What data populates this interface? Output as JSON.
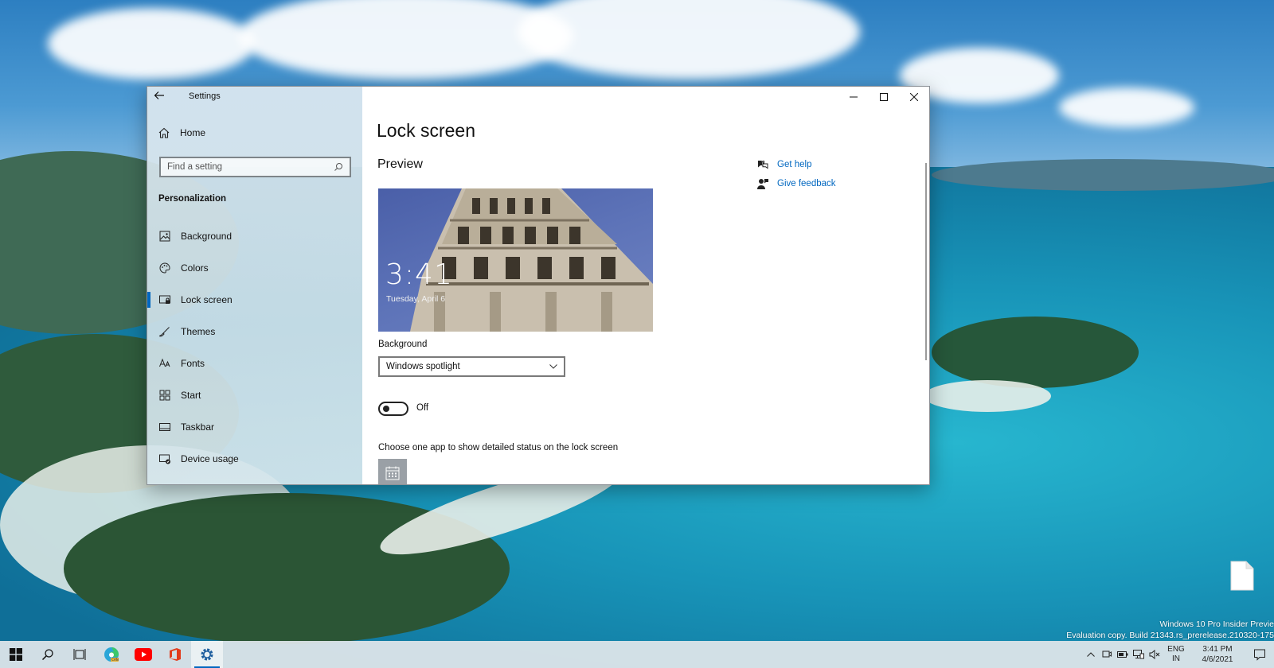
{
  "window": {
    "app_title": "Settings",
    "home_label": "Home",
    "search_placeholder": "Find a setting",
    "section_title": "Personalization",
    "nav_items": [
      {
        "label": "Background",
        "icon": "image-icon",
        "active": false
      },
      {
        "label": "Colors",
        "icon": "palette-icon",
        "active": false
      },
      {
        "label": "Lock screen",
        "icon": "lock-screen-icon",
        "active": true
      },
      {
        "label": "Themes",
        "icon": "brush-icon",
        "active": false
      },
      {
        "label": "Fonts",
        "icon": "font-icon",
        "active": false
      },
      {
        "label": "Start",
        "icon": "start-icon",
        "active": false
      },
      {
        "label": "Taskbar",
        "icon": "taskbar-icon",
        "active": false
      },
      {
        "label": "Device usage",
        "icon": "device-usage-icon",
        "active": false
      }
    ]
  },
  "content": {
    "page_title": "Lock screen",
    "preview_heading": "Preview",
    "preview_time": "3:41",
    "preview_date": "Tuesday, April 6",
    "background_label": "Background",
    "background_value": "Windows spotlight",
    "toggle_state": "Off",
    "status_description": "Choose one app to show detailed status on the lock screen",
    "help_links": [
      {
        "label": "Get help",
        "icon": "help-icon"
      },
      {
        "label": "Give feedback",
        "icon": "feedback-icon"
      }
    ]
  },
  "desktop": {
    "watermark_line1": "Windows 10 Pro Insider Previe",
    "watermark_line2": "Evaluation copy. Build 21343.rs_prerelease.210320-175"
  },
  "taskbar": {
    "apps": [
      "start-icon",
      "search-icon",
      "task-view-icon",
      "edge-canary-icon",
      "youtube-icon",
      "office-icon",
      "settings-icon"
    ],
    "language_line1": "ENG",
    "language_line2": "IN",
    "time": "3:41 PM",
    "date": "4/6/2021"
  },
  "colors": {
    "accent": "#0067c0",
    "link": "#0067c0"
  }
}
